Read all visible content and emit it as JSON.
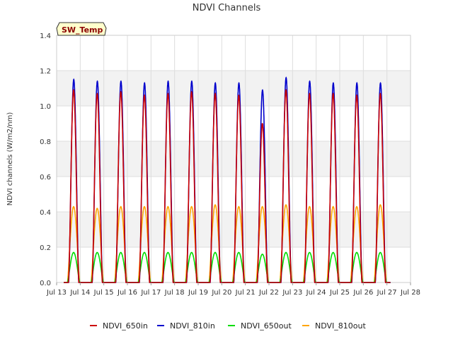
{
  "chart_data": {
    "type": "line",
    "title": "NDVI Channels",
    "ylabel": "NDVI channels (W/m2/nm)",
    "xlabel": "",
    "badge": "SW_Temp",
    "ylim": [
      0,
      1.4
    ],
    "yticks": [
      "0.0",
      "0.2",
      "0.4",
      "0.6",
      "0.8",
      "1.0",
      "1.2",
      "1.4"
    ],
    "xlim_days": [
      13,
      28
    ],
    "xticks": [
      "Jul 13",
      "Jul 14",
      "Jul 15",
      "Jul 16",
      "Jul 17",
      "Jul 18",
      "Jul 19",
      "Jul 20",
      "Jul 21",
      "Jul 22",
      "Jul 23",
      "Jul 24",
      "Jul 25",
      "Jul 26",
      "Jul 27",
      "Jul 28"
    ],
    "grid": true,
    "legend_position": "bottom",
    "peak_days": [
      "Jul 13",
      "Jul 14",
      "Jul 15",
      "Jul 16",
      "Jul 17",
      "Jul 18",
      "Jul 19",
      "Jul 20",
      "Jul 21",
      "Jul 22",
      "Jul 23",
      "Jul 24",
      "Jul 25",
      "Jul 26"
    ],
    "series": [
      {
        "name": "NDVI_650in",
        "color": "#cc0000",
        "peaks": [
          1.09,
          1.07,
          1.08,
          1.06,
          1.07,
          1.08,
          1.07,
          1.06,
          0.9,
          1.09,
          1.07,
          1.07,
          1.06,
          1.07
        ]
      },
      {
        "name": "NDVI_810in",
        "color": "#0000cc",
        "peaks": [
          1.15,
          1.14,
          1.14,
          1.13,
          1.14,
          1.14,
          1.13,
          1.13,
          1.09,
          1.16,
          1.14,
          1.13,
          1.13,
          1.13
        ]
      },
      {
        "name": "NDVI_650out",
        "color": "#00dd00",
        "peaks": [
          0.17,
          0.17,
          0.17,
          0.17,
          0.17,
          0.17,
          0.17,
          0.17,
          0.16,
          0.17,
          0.17,
          0.17,
          0.17,
          0.17
        ]
      },
      {
        "name": "NDVI_810out",
        "color": "#ffa500",
        "peaks": [
          0.43,
          0.42,
          0.43,
          0.43,
          0.43,
          0.43,
          0.44,
          0.43,
          0.43,
          0.44,
          0.43,
          0.43,
          0.43,
          0.44
        ]
      }
    ]
  }
}
